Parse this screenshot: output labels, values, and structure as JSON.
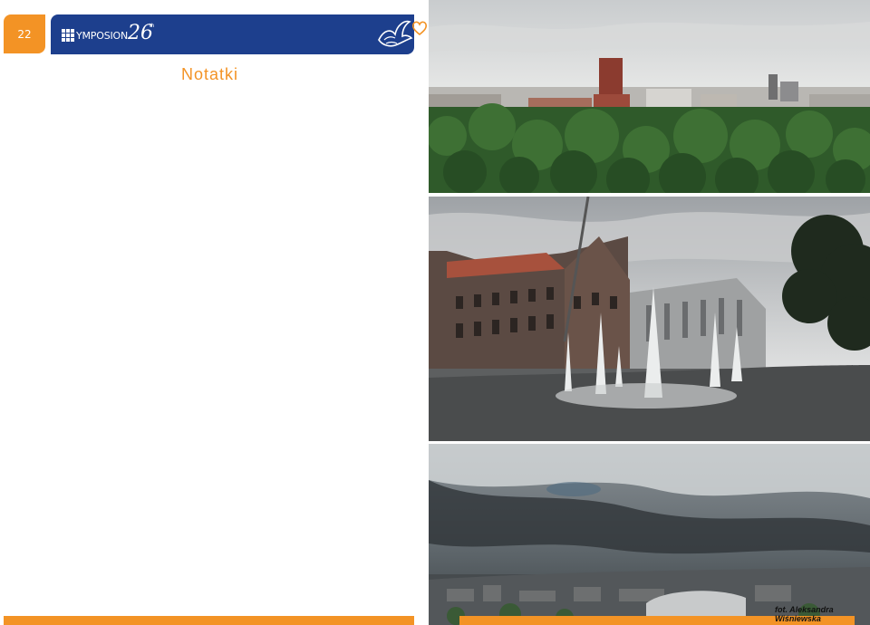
{
  "page_number": "22",
  "header": {
    "brand_text": "YMPOSION",
    "brand_number": "26",
    "brand_sup": "th"
  },
  "notes": {
    "title": "Notatki"
  },
  "photo_credit": "fot. Aleksandra Wiśniewska",
  "colors": {
    "accent": "#f39325",
    "header_blue": "#1d3f8d"
  },
  "photos": [
    {
      "name": "city-panorama-trees"
    },
    {
      "name": "fountain-castle"
    },
    {
      "name": "cloudy-sky-city"
    }
  ]
}
